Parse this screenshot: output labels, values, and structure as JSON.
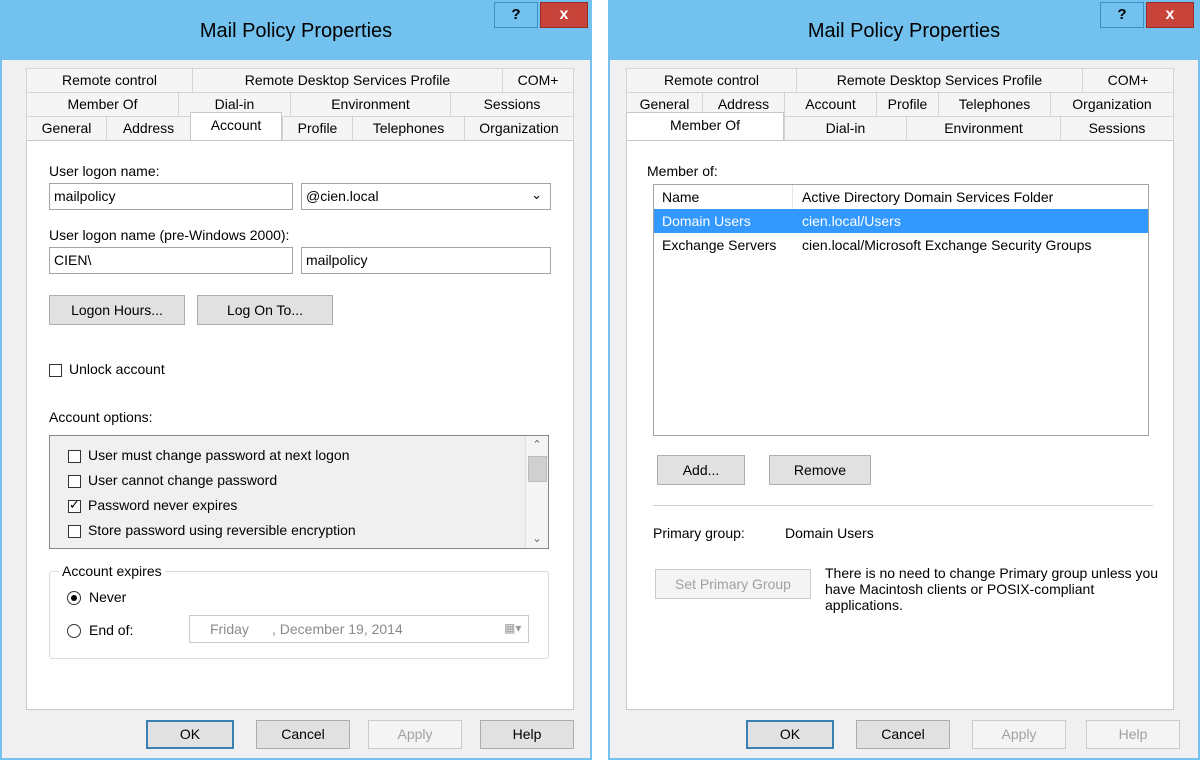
{
  "dialog1": {
    "title": "Mail Policy Properties",
    "help_label": "?",
    "close_label": "x",
    "tabs_row1": [
      "Remote control",
      "Remote Desktop Services Profile",
      "COM+"
    ],
    "tabs_row2": [
      "Member Of",
      "Dial-in",
      "Environment",
      "Sessions"
    ],
    "tabs_row3": [
      "General",
      "Address",
      "Account",
      "Profile",
      "Telephones",
      "Organization"
    ],
    "active_tab": "Account",
    "logon_name_label": "User logon name:",
    "logon_name_value": "mailpolicy",
    "domain_value": "@cien.local",
    "pre2000_label": "User logon name (pre-Windows 2000):",
    "pre2000_domain": "CIEN\\",
    "pre2000_name": "mailpolicy",
    "logon_hours_button": "Logon Hours...",
    "log_on_to_button": "Log On To...",
    "unlock_label": "Unlock account",
    "account_options_label": "Account options:",
    "account_options": [
      {
        "label": "User must change password at next logon",
        "checked": false
      },
      {
        "label": "User cannot change password",
        "checked": false
      },
      {
        "label": "Password never expires",
        "checked": true
      },
      {
        "label": "Store password using reversible encryption",
        "checked": false
      }
    ],
    "account_expires_label": "Account expires",
    "never_label": "Never",
    "end_of_label": "End of:",
    "end_of_day": "Friday",
    "end_of_date": ", December 19, 2014",
    "buttons": {
      "ok": "OK",
      "cancel": "Cancel",
      "apply": "Apply",
      "help": "Help"
    }
  },
  "dialog2": {
    "title": "Mail Policy Properties",
    "help_label": "?",
    "close_label": "x",
    "tabs_row1": [
      "Remote control",
      "Remote Desktop Services Profile",
      "COM+"
    ],
    "tabs_row2": [
      "General",
      "Address",
      "Account",
      "Profile",
      "Telephones",
      "Organization"
    ],
    "tabs_row3": [
      "Member Of",
      "Dial-in",
      "Environment",
      "Sessions"
    ],
    "active_tab": "Member Of",
    "member_of_label": "Member of:",
    "columns": [
      "Name",
      "Active Directory Domain Services Folder"
    ],
    "rows": [
      {
        "name": "Domain Users",
        "folder": "cien.local/Users",
        "selected": true
      },
      {
        "name": "Exchange Servers",
        "folder": "cien.local/Microsoft Exchange Security Groups",
        "selected": false
      }
    ],
    "add_button": "Add...",
    "remove_button": "Remove",
    "primary_group_label": "Primary group:",
    "primary_group_value": "Domain Users",
    "set_primary_button": "Set Primary Group",
    "primary_note": "There is no need to change Primary group unless you have Macintosh clients or POSIX-compliant applications.",
    "buttons": {
      "ok": "OK",
      "cancel": "Cancel",
      "apply": "Apply",
      "help": "Help"
    }
  },
  "colors": {
    "titlebar": "#73c1ee",
    "selection": "#3399ff",
    "close": "#c8443a"
  },
  "icons": [
    "help-icon",
    "close-icon",
    "dropdown-chevron-icon",
    "scroll-up-icon",
    "scroll-down-icon",
    "calendar-icon"
  ]
}
